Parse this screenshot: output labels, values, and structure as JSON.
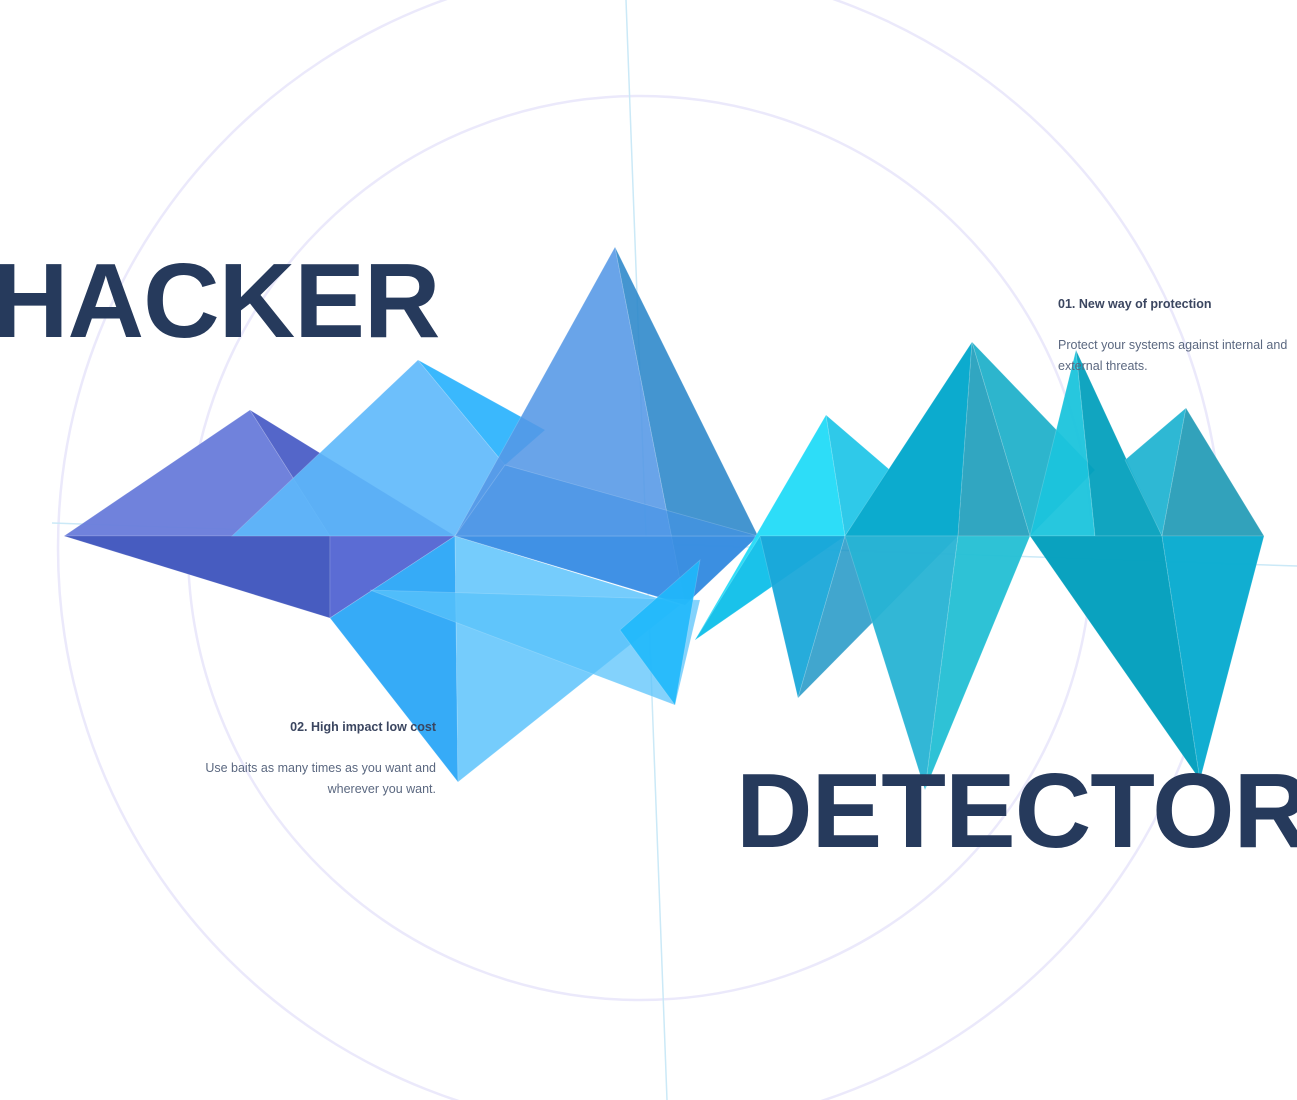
{
  "headline": {
    "top_word": "HACKER",
    "bottom_word": "DETECTOR"
  },
  "features": [
    {
      "title": "01. New way of protection",
      "description": "Protect your systems against internal and external threats."
    },
    {
      "title": "02. High impact low cost",
      "description": "Use baits as many times as you want and wherever you want."
    }
  ],
  "colors": {
    "headline": "#263a5c",
    "rings": "#ebe9fb",
    "crosshair": "#cbe9f7",
    "violet": "#4c5bd0",
    "blue": "#2aa4f4",
    "cyan": "#1ed6f2",
    "teal": "#0aa3c2"
  }
}
